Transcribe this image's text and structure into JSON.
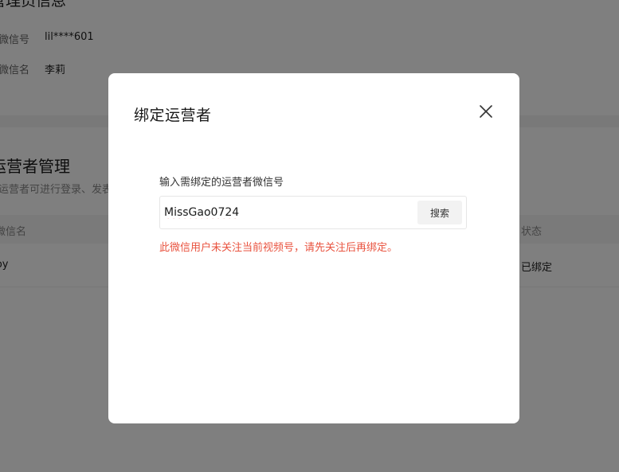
{
  "background": {
    "admin_section": {
      "title": "管理员信息",
      "rows": [
        {
          "label": "微信号",
          "value": "lil****601"
        },
        {
          "label": "微信名",
          "value": "李莉"
        }
      ]
    },
    "operator_section": {
      "title": "运营者管理",
      "description": "运营者可进行登录、发表",
      "table": {
        "headers": {
          "name": "微信名",
          "status": "状态"
        },
        "rows": [
          {
            "name": "Joy",
            "status": "已绑定"
          }
        ]
      }
    }
  },
  "modal": {
    "title": "绑定运营者",
    "close_icon": "close-icon",
    "field_label": "输入需绑定的运营者微信号",
    "search_value": "MissGao0724",
    "search_button_label": "搜索",
    "error_message": "此微信用户未关注当前视频号，请先关注后再绑定。",
    "error_color": "#e9533f"
  }
}
